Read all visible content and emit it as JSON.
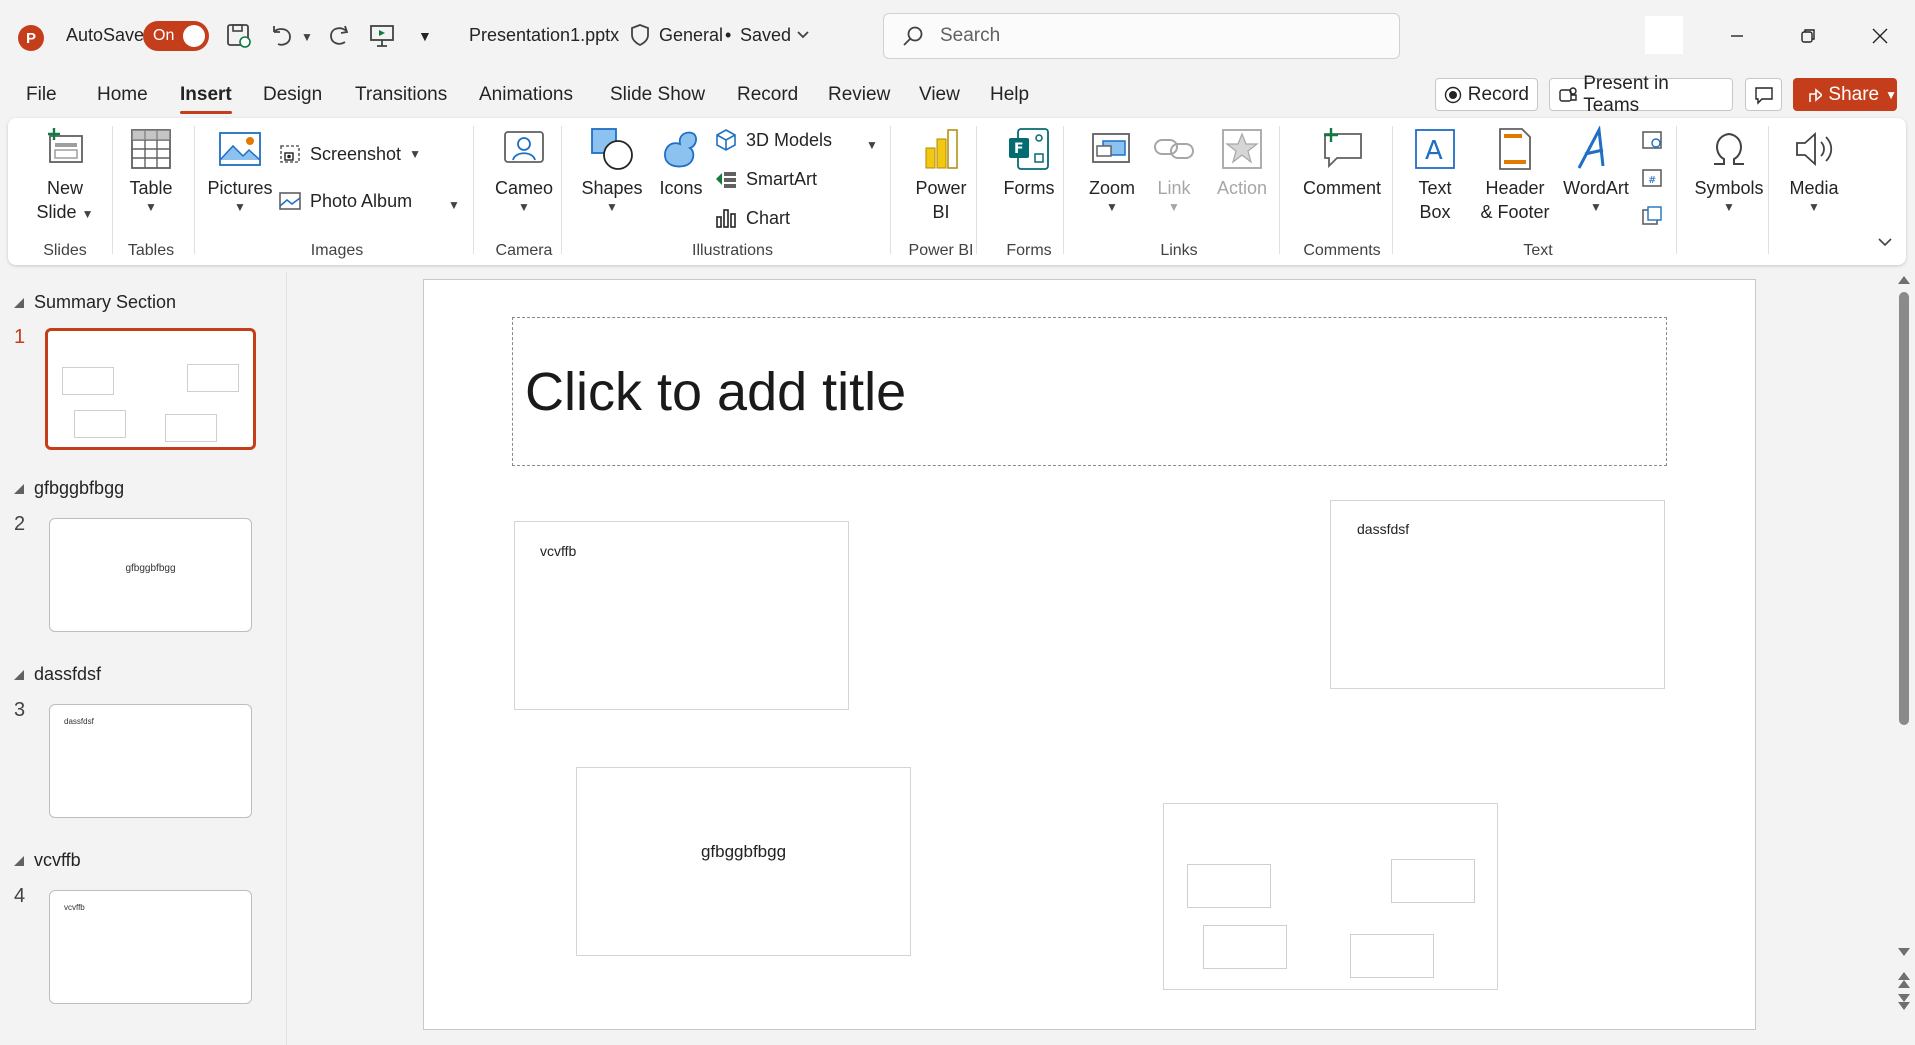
{
  "titlebar": {
    "app_logo": "P",
    "autosave_label": "AutoSave",
    "autosave_state": "On",
    "filename": "Presentation1.pptx",
    "sensitivity": "General",
    "save_state": "Saved",
    "search_placeholder": "Search"
  },
  "menu": {
    "tabs": [
      "File",
      "Home",
      "Insert",
      "Design",
      "Transitions",
      "Animations",
      "Slide Show",
      "Record",
      "Review",
      "View",
      "Help"
    ],
    "active_tab": "Insert",
    "record_label": "Record",
    "present_label": "Present in Teams",
    "share_label": "Share"
  },
  "ribbon": {
    "new_slide": [
      "New",
      "Slide"
    ],
    "table": "Table",
    "pictures": "Pictures",
    "screenshot": "Screenshot",
    "photo_album": "Photo Album",
    "cameo": "Cameo",
    "shapes": "Shapes",
    "icons": "Icons",
    "models": "3D Models",
    "smartart": "SmartArt",
    "chart": "Chart",
    "powerbi": [
      "Power",
      "BI"
    ],
    "forms": "Forms",
    "zoom": "Zoom",
    "link": "Link",
    "action": "Action",
    "comment": "Comment",
    "textbox": [
      "Text",
      "Box"
    ],
    "header_footer": [
      "Header",
      "& Footer"
    ],
    "wordart": "WordArt",
    "symbols": "Symbols",
    "media": "Media",
    "groups": {
      "slides": "Slides",
      "tables": "Tables",
      "images": "Images",
      "camera": "Camera",
      "illustrations": "Illustrations",
      "powerbi": "Power BI",
      "forms": "Forms",
      "links": "Links",
      "comments": "Comments",
      "text": "Text"
    }
  },
  "thumbnails": [
    {
      "section": "Summary Section",
      "number": "1"
    },
    {
      "section": "gfbggbfbgg",
      "number": "2",
      "text": "gfbggbfbgg"
    },
    {
      "section": "dassfdsf",
      "number": "3",
      "text": "dassfdsf"
    },
    {
      "section": "vcvffb",
      "number": "4",
      "text": "vcvffb"
    }
  ],
  "slide": {
    "title_placeholder": "Click to add title",
    "box1": "vcvffb",
    "box2": "dassfdsf",
    "box3": "gfbggbfbgg"
  }
}
